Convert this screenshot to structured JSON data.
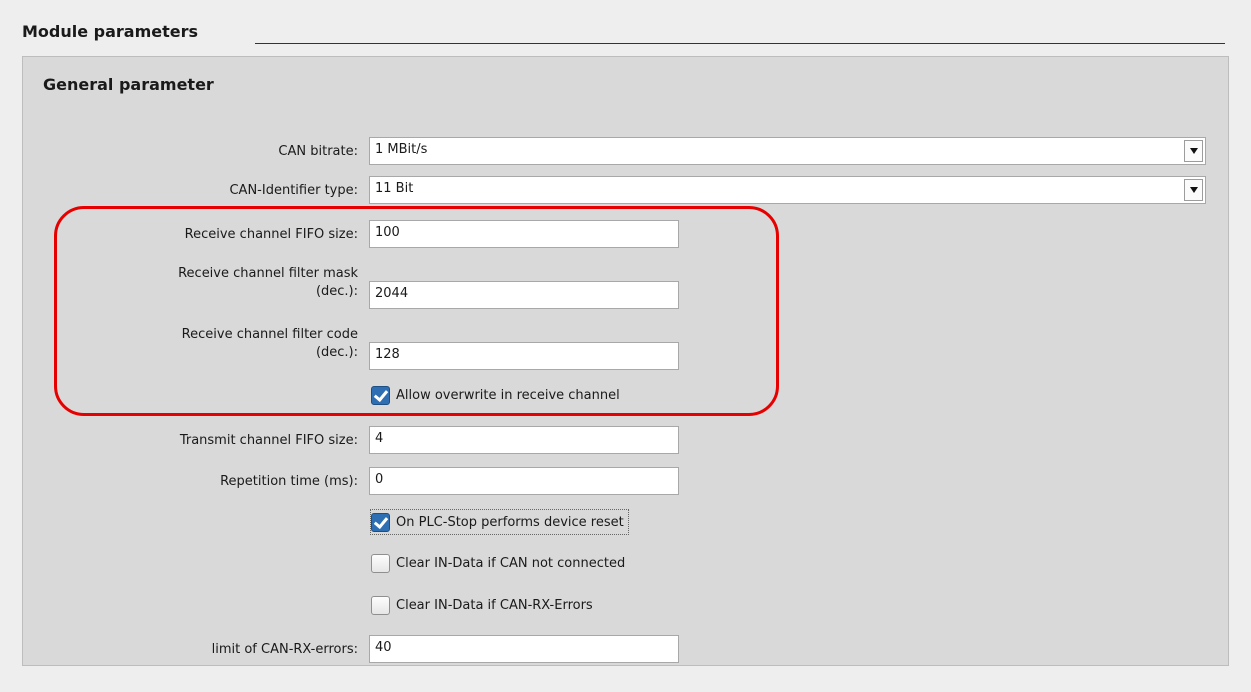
{
  "module_parameters": {
    "title": "Module parameters"
  },
  "general_parameter": {
    "title": "General parameter",
    "can_bitrate": {
      "label": "CAN bitrate:",
      "value": "1 MBit/s"
    },
    "can_identifier_type": {
      "label": "CAN-Identifier type:",
      "value": "11 Bit"
    },
    "receive_fifo_size": {
      "label": "Receive channel FIFO size:",
      "value": "100"
    },
    "receive_filter_mask": {
      "label_line1": "Receive channel filter mask",
      "label_line2": "(dec.):",
      "value": "2044"
    },
    "receive_filter_code": {
      "label_line1": "Receive channel filter code",
      "label_line2": "(dec.):",
      "value": "128"
    },
    "allow_overwrite": {
      "label": "Allow overwrite in receive channel",
      "checked": true
    },
    "transmit_fifo_size": {
      "label": "Transmit channel FIFO size:",
      "value": "4"
    },
    "repetition_time": {
      "label": "Repetition time (ms):",
      "value": "0"
    },
    "plc_stop_reset": {
      "label": "On PLC-Stop performs device reset",
      "checked": true
    },
    "clear_in_data_not_connected": {
      "label": "Clear IN-Data if CAN not connected",
      "checked": false
    },
    "clear_in_data_rx_errors": {
      "label": "Clear IN-Data if CAN-RX-Errors",
      "checked": false
    },
    "limit_rx_errors": {
      "label": "limit of CAN-RX-errors:",
      "value": "40"
    }
  },
  "colors": {
    "highlight": "#e60000",
    "checkbox_checked": "#2e6fb3",
    "panel_background": "#d9d9d9"
  }
}
